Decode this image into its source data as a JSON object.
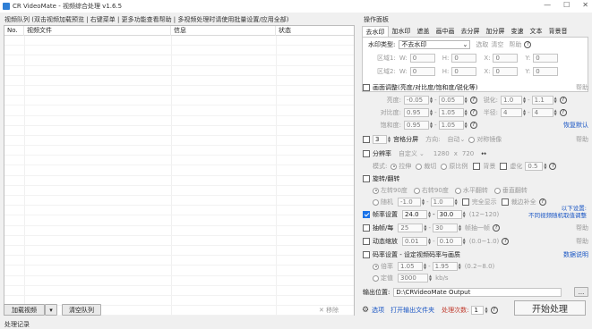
{
  "window": {
    "title": "CR VideoMate - 视频综合处理 v1.6.5",
    "minimize": "—",
    "maximize": "☐",
    "close": "✕"
  },
  "left": {
    "list_label": "视频队列 (双击视频加载预览 | 右键菜单 | 更多功能查看帮助 | 多视频处理时请使用批量设置/应用全部)",
    "columns": [
      "No.",
      "视频文件",
      "信息",
      "状态"
    ],
    "add_video": "加载视频",
    "clear_queue": "清空队列",
    "remove": "✕ 移除",
    "status": "处理记录"
  },
  "right": {
    "section_title": "操作面板",
    "tabs": [
      "去水印",
      "加水印",
      "遮盖",
      "画中画",
      "去分屏",
      "加分屏",
      "变速",
      "文本",
      "背景音"
    ],
    "watermark": {
      "mode_label": "水印类型:",
      "mode_value": "不去水印",
      "select": "选取",
      "clear": "清空",
      "help": "帮助",
      "area1": "区域1:",
      "area2": "区域2:",
      "w": "W:",
      "h": "H:",
      "x": "X:",
      "y": "Y:",
      "zero": "0"
    },
    "color_adjust": {
      "label": "画面调整(亮度/对比度/饱和度/锐化等)",
      "help": "帮助",
      "brightness": "亮度:",
      "b_min": "-0.05",
      "b_max": "0.05",
      "contrast": "对比度:",
      "c_min": "0.95",
      "c_max": "1.05",
      "saturation": "饱和度:",
      "s_min": "0.95",
      "s_max": "1.05",
      "sharpen": "锐化:",
      "sh_min": "1.0",
      "sh_max": "1.1",
      "radius": "半径:",
      "r_min": "4",
      "r_max": "4",
      "restore": "恢复默认",
      "dash": "-"
    },
    "split": {
      "count": "3",
      "label": "宫格分屏",
      "dir_label": "方向:",
      "dir_value": "自动",
      "symm": "对称镜像",
      "help": "帮助"
    },
    "resolution": {
      "label": "分辨率",
      "preset": "自定义",
      "w": "1280",
      "x": "x",
      "h": "720",
      "swap": "↔",
      "mode_label": "模式:",
      "stretch": "拉伸",
      "fill": "裁切",
      "ratio": "原比例",
      "bg": "背景",
      "blur": "虚化",
      "blur_val": "0.5",
      "help": "帮助"
    },
    "flip": {
      "label": "旋转/翻转",
      "r90": "左转90度",
      "r90b": "右转90度",
      "hflip": "水平翻转",
      "vflip": "垂直翻转",
      "random": "随机",
      "rmin": "-1.0",
      "rmax": "1.0",
      "full": "完全显示",
      "crop": "裁边补全",
      "help1": "以下设置:",
      "help2": "不同视频随机取值调整"
    },
    "fps": {
      "label": "帧率设置",
      "min": "24.0",
      "max": "30.0",
      "range": "(12~120)"
    },
    "extract": {
      "label": "抽帧/每",
      "a": "25",
      "b": "30",
      "tail": "帧抽一帧",
      "help": "帮助"
    },
    "speed": {
      "label": "动态缩放",
      "min": "0.01",
      "max": "0.10",
      "range": "(0.0~1.0)",
      "help": "帮助"
    },
    "bitrate": {
      "label": "码率设置 - 设定视频码率与画质",
      "help": "数据说明",
      "mult": "倍率",
      "m_min": "1.05",
      "m_max": "1.95",
      "m_range": "(0.2~8.0)",
      "fixed": "定值",
      "fixed_val": "3000",
      "unit": "kb/s"
    },
    "output": {
      "label": "输出位置:",
      "path": "D:\\CRVideoMate Output",
      "browse": "..."
    },
    "footer": {
      "settings": "选项",
      "open_dir": "打开输出文件夹",
      "concurrency_label": "处理次数:",
      "concurrency": "1",
      "start": "开始处理"
    }
  }
}
